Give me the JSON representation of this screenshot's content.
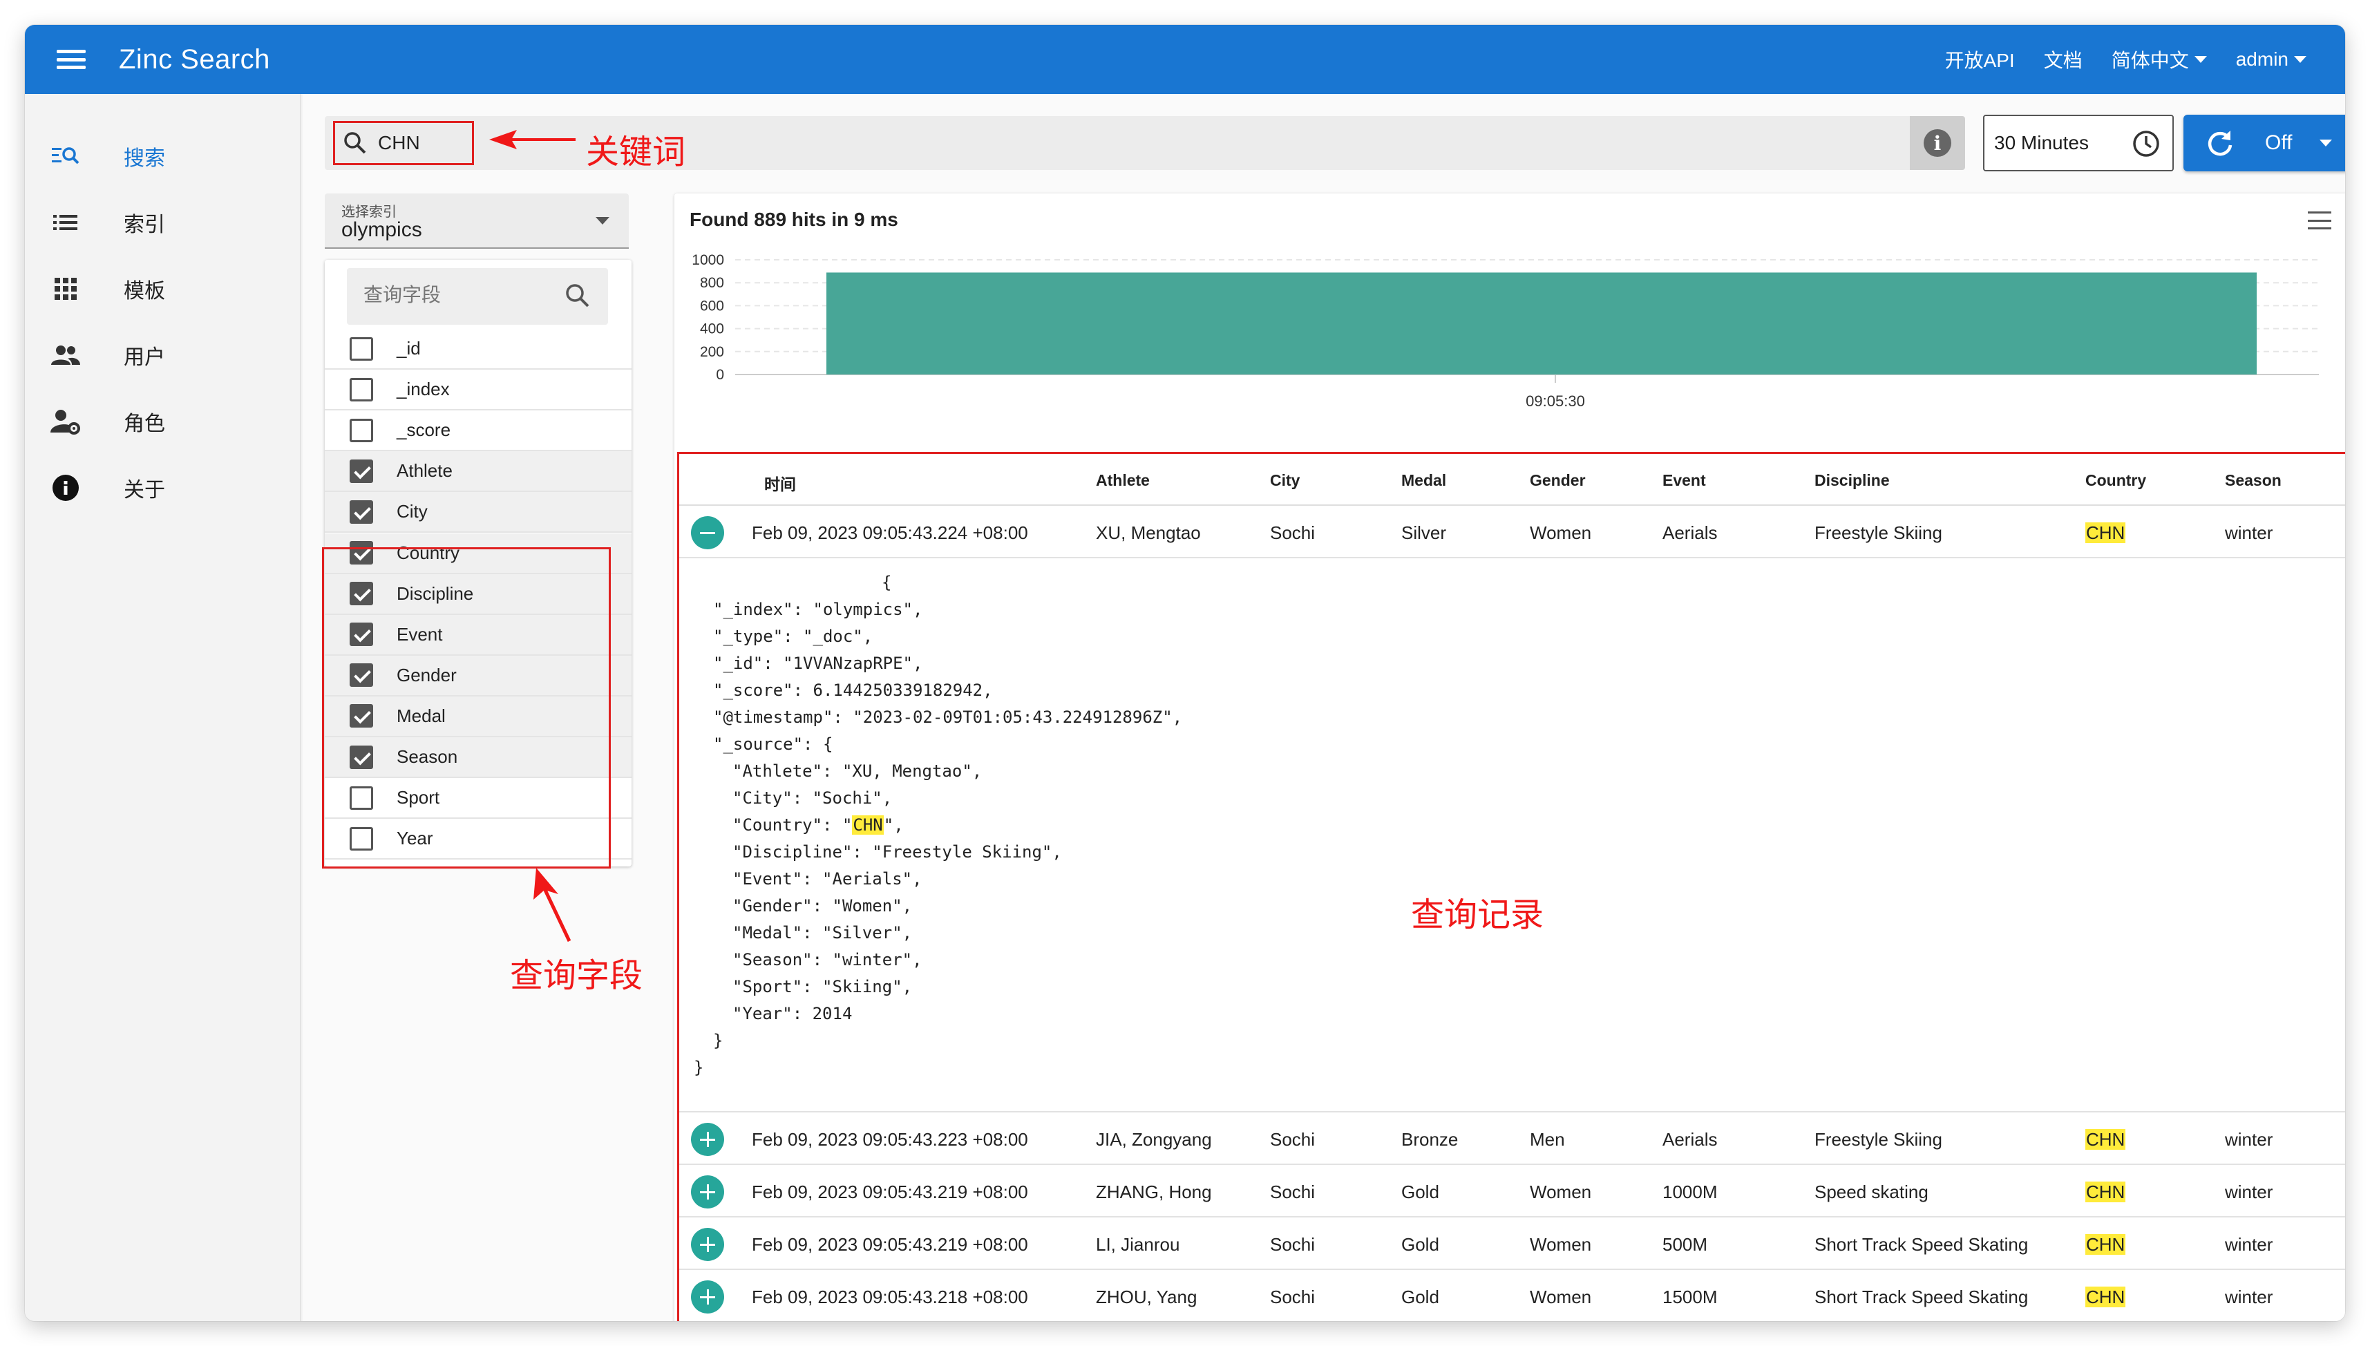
{
  "app": {
    "title": "Zinc Search"
  },
  "header": {
    "links": [
      "开放API",
      "文档"
    ],
    "language": "简体中文",
    "user": "admin"
  },
  "sidebar": {
    "items": [
      {
        "label": "搜索",
        "icon": "search-list-icon",
        "active": true
      },
      {
        "label": "索引",
        "icon": "list-icon"
      },
      {
        "label": "模板",
        "icon": "grid-icon"
      },
      {
        "label": "用户",
        "icon": "people-icon"
      },
      {
        "label": "角色",
        "icon": "user-gear-icon"
      },
      {
        "label": "关于",
        "icon": "info-icon"
      }
    ]
  },
  "search": {
    "value": "CHN"
  },
  "time_range": {
    "value": "30 Minutes"
  },
  "refresh": {
    "label": "Off"
  },
  "index_select": {
    "label": "选择索引",
    "value": "olympics"
  },
  "fields": {
    "placeholder": "查询字段",
    "items": [
      {
        "name": "_id",
        "checked": false
      },
      {
        "name": "_index",
        "checked": false
      },
      {
        "name": "_score",
        "checked": false
      },
      {
        "name": "Athlete",
        "checked": true
      },
      {
        "name": "City",
        "checked": true
      },
      {
        "name": "Country",
        "checked": true
      },
      {
        "name": "Discipline",
        "checked": true
      },
      {
        "name": "Event",
        "checked": true
      },
      {
        "name": "Gender",
        "checked": true
      },
      {
        "name": "Medal",
        "checked": true
      },
      {
        "name": "Season",
        "checked": true
      },
      {
        "name": "Sport",
        "checked": false
      },
      {
        "name": "Year",
        "checked": false
      }
    ]
  },
  "results": {
    "summary": "Found 889 hits in 9 ms",
    "columns": [
      "时间",
      "Athlete",
      "City",
      "Medal",
      "Gender",
      "Event",
      "Discipline",
      "Country",
      "Season"
    ],
    "rows": [
      [
        "Feb 09, 2023 09:05:43.224 +08:00",
        "XU, Mengtao",
        "Sochi",
        "Silver",
        "Women",
        "Aerials",
        "Freestyle Skiing",
        "CHN",
        "winter"
      ],
      [
        "Feb 09, 2023 09:05:43.223 +08:00",
        "JIA, Zongyang",
        "Sochi",
        "Bronze",
        "Men",
        "Aerials",
        "Freestyle Skiing",
        "CHN",
        "winter"
      ],
      [
        "Feb 09, 2023 09:05:43.219 +08:00",
        "ZHANG, Hong",
        "Sochi",
        "Gold",
        "Women",
        "1000M",
        "Speed skating",
        "CHN",
        "winter"
      ],
      [
        "Feb 09, 2023 09:05:43.219 +08:00",
        "LI, Jianrou",
        "Sochi",
        "Gold",
        "Women",
        "500M",
        "Short Track Speed Skating",
        "CHN",
        "winter"
      ],
      [
        "Feb 09, 2023 09:05:43.218 +08:00",
        "ZHOU, Yang",
        "Sochi",
        "Gold",
        "Women",
        "1500M",
        "Short Track Speed Skating",
        "CHN",
        "winter"
      ]
    ],
    "expanded_json": {
      "open": "{",
      "lines": [
        "\"_index\": \"olympics\",",
        "\"_type\": \"_doc\",",
        "\"_id\": \"1VVANzapRPE\",",
        "\"_score\": 6.144250339182942,",
        "\"@timestamp\": \"2023-02-09T01:05:43.224912896Z\",",
        "\"_source\": {",
        "\"Athlete\": \"XU, Mengtao\",",
        "\"City\": \"Sochi\",",
        "\"Country\": \"CHN\",",
        "\"Discipline\": \"Freestyle Skiing\",",
        "\"Event\": \"Aerials\",",
        "\"Gender\": \"Women\",",
        "\"Medal\": \"Silver\",",
        "\"Season\": \"winter\",",
        "\"Sport\": \"Skiing\",",
        "\"Year\": 2014",
        "}",
        "}"
      ]
    }
  },
  "chart_data": {
    "type": "bar",
    "categories": [
      "09:05:30"
    ],
    "values": [
      889
    ],
    "ylim": [
      0,
      1000
    ],
    "yticks": [
      0,
      200,
      400,
      600,
      800,
      1000
    ],
    "color": "#48a697"
  },
  "annotations": {
    "keyword": "关键词",
    "fields": "查询字段",
    "records": "查询记录"
  },
  "colors": {
    "primary": "#1976d2",
    "annotation": "#f01818",
    "highlight": "#ffeb3b",
    "toggle": "#26a69a"
  }
}
